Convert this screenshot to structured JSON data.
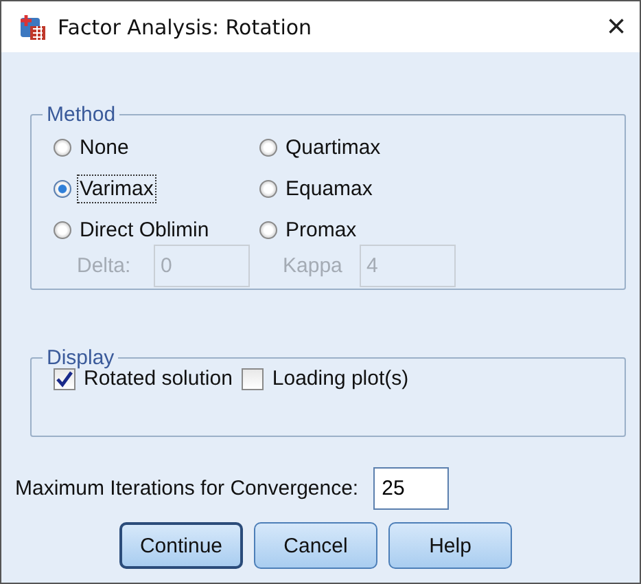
{
  "window": {
    "title": "Factor Analysis: Rotation",
    "close": "×"
  },
  "method": {
    "legend": "Method",
    "options": [
      {
        "label": "None",
        "selected": false,
        "focused": false
      },
      {
        "label": "Quartimax",
        "selected": false,
        "focused": false
      },
      {
        "label": "Varimax",
        "selected": true,
        "focused": true
      },
      {
        "label": "Equamax",
        "selected": false,
        "focused": false
      },
      {
        "label": "Direct Oblimin",
        "selected": false,
        "focused": false
      },
      {
        "label": "Promax",
        "selected": false,
        "focused": false
      }
    ],
    "params": [
      {
        "label": "Delta:",
        "value": "0",
        "disabled": true
      },
      {
        "label": "Kappa",
        "value": "4",
        "disabled": true
      }
    ]
  },
  "display": {
    "legend": "Display",
    "options": [
      {
        "label": "Rotated solution",
        "checked": true
      },
      {
        "label": "Loading plot(s)",
        "checked": false
      }
    ]
  },
  "iterations": {
    "label": "Maximum Iterations for Convergence:",
    "value": "25"
  },
  "buttons": [
    {
      "label": "Continue",
      "default": true
    },
    {
      "label": "Cancel",
      "default": false
    },
    {
      "label": "Help",
      "default": false
    }
  ]
}
